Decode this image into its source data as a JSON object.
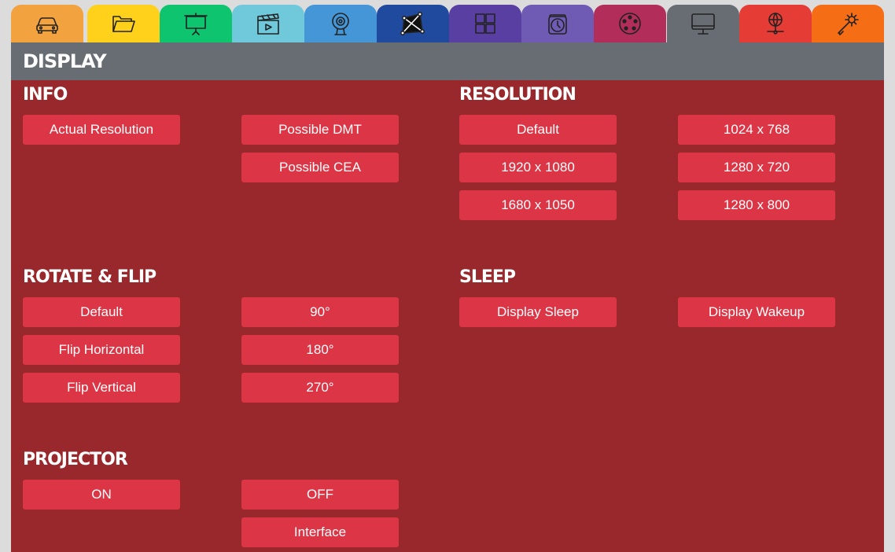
{
  "tabs": [
    {
      "icon": "car-icon",
      "color": "#f2a23e"
    },
    {
      "icon": "folder-icon",
      "color": "#ffd11a"
    },
    {
      "icon": "projector-screen-icon",
      "color": "#0ec46f"
    },
    {
      "icon": "clapperboard-icon",
      "color": "#6fc9db"
    },
    {
      "icon": "webcam-icon",
      "color": "#4496d6"
    },
    {
      "icon": "projection-mapping-icon",
      "color": "#1f4a9e"
    },
    {
      "icon": "grid-layout-icon",
      "color": "#583fa1"
    },
    {
      "icon": "alarm-clock-icon",
      "color": "#6f5bb4"
    },
    {
      "icon": "dmx-connector-icon",
      "color": "#b22d5a"
    },
    {
      "icon": "monitor-icon",
      "color": "#676d73",
      "active": true
    },
    {
      "icon": "network-globe-icon",
      "color": "#e53d35"
    },
    {
      "icon": "wrench-gear-icon",
      "color": "#f56d15"
    }
  ],
  "header": {
    "title": "DISPLAY"
  },
  "info": {
    "title": "INFO",
    "actual_resolution": "Actual Resolution",
    "possible_dmt": "Possible DMT",
    "possible_cea": "Possible CEA"
  },
  "resolution": {
    "title": "RESOLUTION",
    "default": "Default",
    "r1024x768": "1024 x 768",
    "r1920x1080": "1920 x 1080",
    "r1280x720": "1280 x 720",
    "r1680x1050": "1680 x 1050",
    "r1280x800": "1280 x 800"
  },
  "rotate": {
    "title": "ROTATE & FLIP",
    "default": "Default",
    "deg90": "90°",
    "flip_horizontal": "Flip Horizontal",
    "deg180": "180°",
    "flip_vertical": "Flip Vertical",
    "deg270": "270°"
  },
  "sleep": {
    "title": "SLEEP",
    "display_sleep": "Display Sleep",
    "display_wakeup": "Display Wakeup"
  },
  "projector": {
    "title": "PROJECTOR",
    "on": "ON",
    "off": "OFF",
    "interface": "Interface"
  },
  "colors": {
    "panel": "#98282c",
    "button": "#dc3545",
    "header": "#676d73"
  }
}
